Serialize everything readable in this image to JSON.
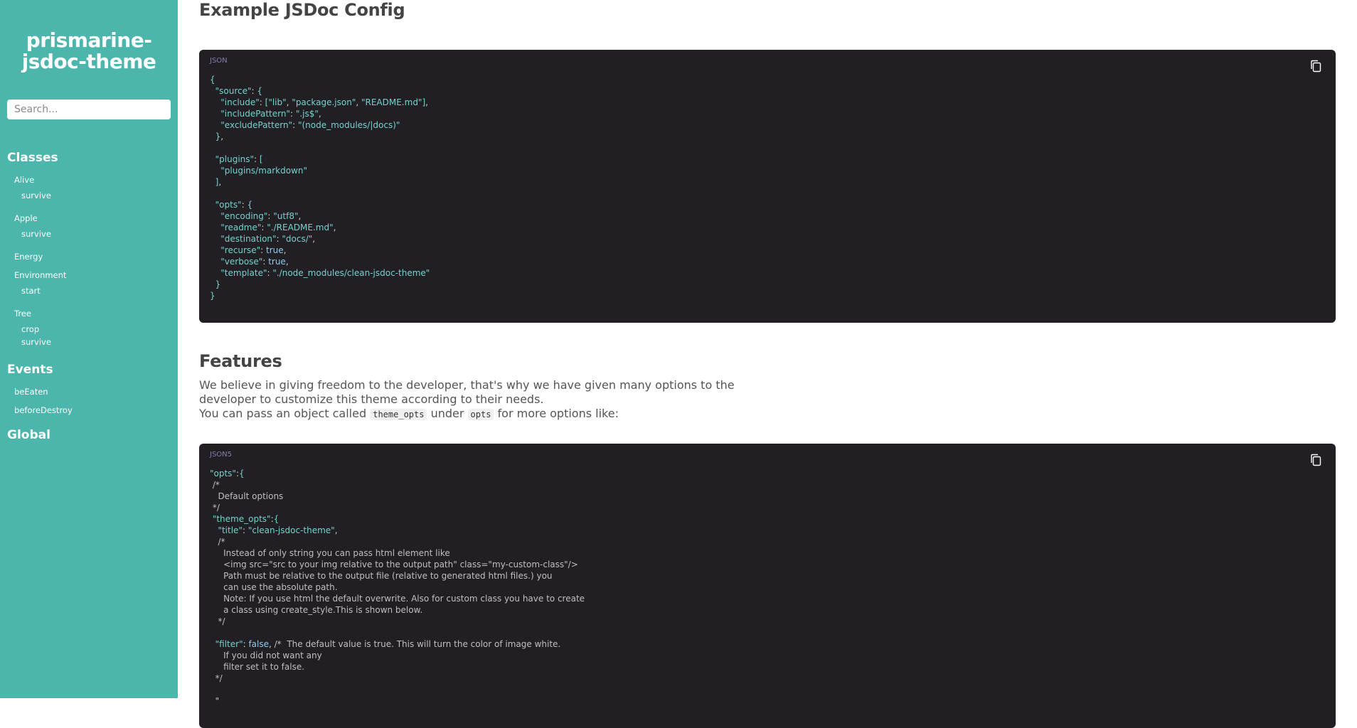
{
  "sidebar": {
    "title": "prismarine-jsdoc-theme",
    "search_placeholder": "Search...",
    "sections": [
      {
        "heading": "Classes"
      },
      {
        "heading": "Events"
      },
      {
        "heading": "Global"
      }
    ],
    "classes": {
      "alive": "Alive",
      "alive_survive": "survive",
      "apple": "Apple",
      "apple_survive": "survive",
      "energy": "Energy",
      "environment": "Environment",
      "environment_start": "start",
      "tree": "Tree",
      "tree_crop": "crop",
      "tree_survive": "survive"
    },
    "events": {
      "be_eaten": "beEaten",
      "before_destroy": "beforeDestroy"
    }
  },
  "main": {
    "example_heading": "Example JSDoc Config",
    "example_lang": "JSON",
    "features_heading": "Features",
    "features_para_1": "We believe in giving freedom to the developer, that's why we have given many options to the developer to customize this theme according to their needs.",
    "features_para_2_prefix": "You can pass an object called",
    "features_code_1": "theme_opts",
    "features_para_2_mid": "under",
    "features_code_2": "opts",
    "features_para_2_suffix": "for more options like:",
    "options_lang": "JSON5"
  },
  "code_json_lines": [
    "{",
    "  \"source\": {",
    "    \"include\": [\"lib\", \"package.json\", \"README.md\"],",
    "    \"includePattern\": \".js$\",",
    "    \"excludePattern\": \"(node_modules/|docs)\"",
    "  },",
    "",
    "  \"plugins\": [",
    "    \"plugins/markdown\"",
    "  ],",
    "",
    "  \"opts\": {",
    "    \"encoding\": \"utf8\",",
    "    \"readme\": \"./README.md\",",
    "    \"destination\": \"docs/\",",
    "    \"recurse\": true,",
    "    \"verbose\": true,",
    "    \"template\": \"./node_modules/clean-jsdoc-theme\"",
    "  }",
    "}"
  ],
  "code_json5_lines": [
    "\"opts\":{",
    " /*",
    "   Default options",
    " */",
    " \"theme_opts\":{",
    "   \"title\": \"clean-jsdoc-theme\",",
    "   /*",
    "     Instead of only string you can pass html element like",
    "     <img src=\"src to your img relative to the output path\" class=\"my-custom-class\"/>",
    "     Path must be relative to the output file (relative to generated html files.) you",
    "     can use the absolute path.",
    "     Note: If you use html the default overwrite. Also for custom class you have to create",
    "     a class using create_style.This is shown below.",
    "   */",
    "",
    "  \"filter\": false, /*  The default value is true. This will turn the color of image white.",
    "     If you did not want any",
    "     filter set it to false.",
    "  */",
    "",
    "  \""
  ],
  "colors": {
    "sidebar_bg": "#4db6ac",
    "code_bg": "#221f24",
    "code_key": "#74d3ca",
    "code_bool": "#8ecdf0"
  }
}
